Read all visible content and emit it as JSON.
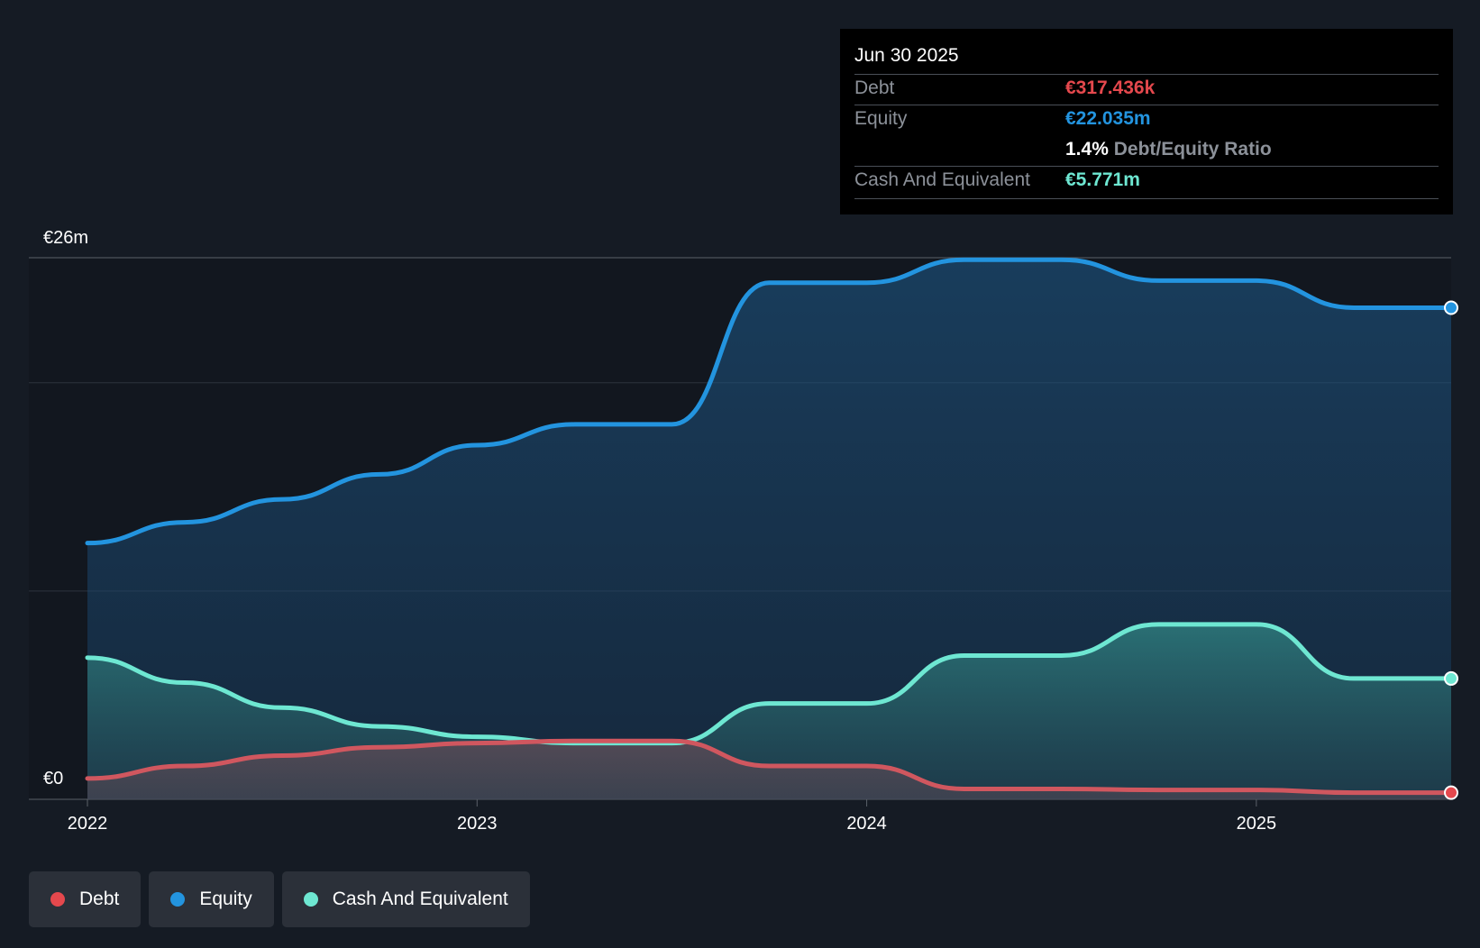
{
  "tooltip": {
    "date": "Jun 30 2025",
    "debt_label": "Debt",
    "debt_value": "€317.436k",
    "equity_label": "Equity",
    "equity_value": "€22.035m",
    "ratio_value": "1.4%",
    "ratio_label": "Debt/Equity Ratio",
    "cash_label": "Cash And Equivalent",
    "cash_value": "€5.771m"
  },
  "legend": [
    {
      "label": "Debt",
      "color": "#e5484d"
    },
    {
      "label": "Equity",
      "color": "#2394df"
    },
    {
      "label": "Cash And Equivalent",
      "color": "#6ee7d2"
    }
  ],
  "colors": {
    "debt": "#e5484d",
    "debt_line": "#d0575f",
    "equity": "#2394df",
    "cash": "#6ee7d2",
    "background": "#151b24"
  },
  "chart_data": {
    "type": "area",
    "ylim": [
      0,
      26
    ],
    "y_tick_labels": [
      "€26m",
      "€0"
    ],
    "x_tick_labels": [
      "2022",
      "2023",
      "2024",
      "2025"
    ],
    "x_ticks": [
      2022.0,
      2023.0,
      2024.0,
      2025.0
    ],
    "xlim": [
      2021.85,
      2025.5
    ],
    "series": [
      {
        "name": "Equity",
        "color": "#2394df",
        "points": [
          [
            2022.0,
            12.3
          ],
          [
            2022.25,
            13.3
          ],
          [
            2022.5,
            14.4
          ],
          [
            2022.75,
            15.6
          ],
          [
            2023.0,
            17.0
          ],
          [
            2023.25,
            18.0
          ],
          [
            2023.5,
            18.0
          ],
          [
            2023.75,
            24.8
          ],
          [
            2024.0,
            24.8
          ],
          [
            2024.25,
            25.9
          ],
          [
            2024.5,
            25.9
          ],
          [
            2024.75,
            24.9
          ],
          [
            2025.0,
            24.9
          ],
          [
            2025.25,
            23.6
          ],
          [
            2025.5,
            23.6
          ]
        ]
      },
      {
        "name": "Cash And Equivalent",
        "color": "#6ee7d2",
        "points": [
          [
            2022.0,
            6.8
          ],
          [
            2022.25,
            5.6
          ],
          [
            2022.5,
            4.4
          ],
          [
            2022.75,
            3.5
          ],
          [
            2023.0,
            3.0
          ],
          [
            2023.25,
            2.7
          ],
          [
            2023.5,
            2.7
          ],
          [
            2023.75,
            4.6
          ],
          [
            2024.0,
            4.6
          ],
          [
            2024.25,
            6.9
          ],
          [
            2024.5,
            6.9
          ],
          [
            2024.75,
            8.4
          ],
          [
            2025.0,
            8.4
          ],
          [
            2025.25,
            5.8
          ],
          [
            2025.5,
            5.8
          ]
        ]
      },
      {
        "name": "Debt",
        "color": "#e5484d",
        "points": [
          [
            2022.0,
            1.0
          ],
          [
            2022.25,
            1.6
          ],
          [
            2022.5,
            2.1
          ],
          [
            2022.75,
            2.5
          ],
          [
            2023.0,
            2.7
          ],
          [
            2023.25,
            2.8
          ],
          [
            2023.5,
            2.8
          ],
          [
            2023.75,
            1.6
          ],
          [
            2024.0,
            1.6
          ],
          [
            2024.25,
            0.5
          ],
          [
            2024.5,
            0.5
          ],
          [
            2024.75,
            0.45
          ],
          [
            2025.0,
            0.45
          ],
          [
            2025.25,
            0.32
          ],
          [
            2025.5,
            0.32
          ]
        ]
      }
    ]
  }
}
